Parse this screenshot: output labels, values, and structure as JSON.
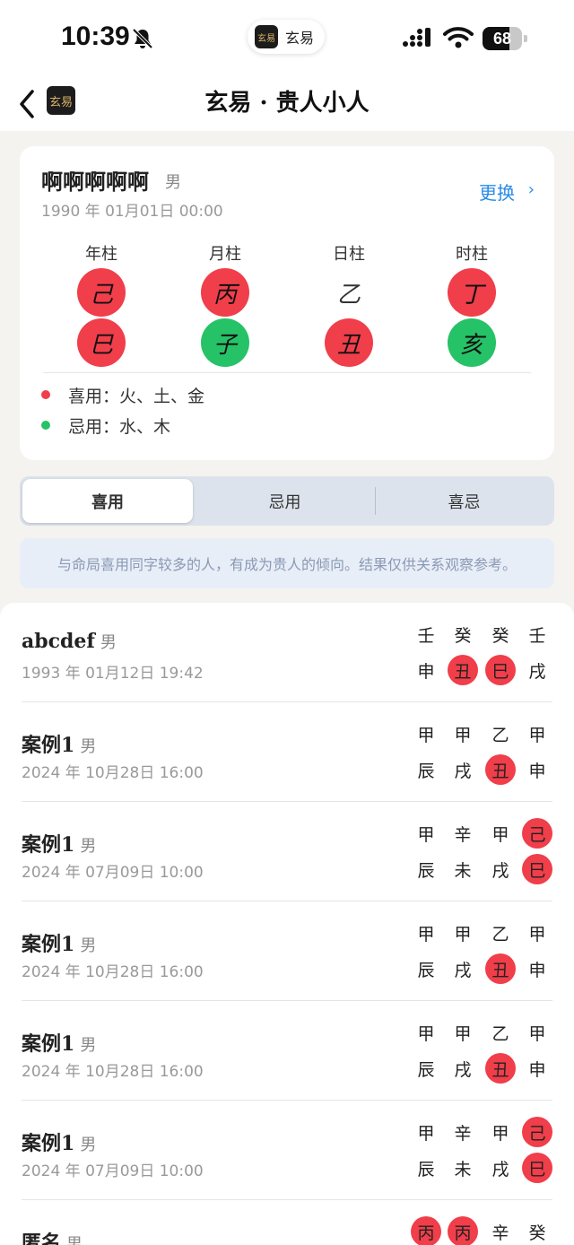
{
  "status_bar": {
    "time": "10:39",
    "app_pill_logo": "玄易",
    "app_pill_text": "玄易",
    "battery": "68",
    "battery_level": 0.68
  },
  "nav": {
    "logo": "玄易",
    "title": "玄易 · 贵人小人"
  },
  "profile": {
    "name": "啊啊啊啊啊",
    "gender": "男",
    "date": "1990 年 01月01日  00:00",
    "change_label": "更换",
    "change_chevron": "›",
    "pillars": [
      {
        "label": "年柱",
        "stem": "己",
        "stem_color": "red",
        "branch": "巳",
        "branch_color": "red"
      },
      {
        "label": "月柱",
        "stem": "丙",
        "stem_color": "red",
        "branch": "子",
        "branch_color": "green"
      },
      {
        "label": "日柱",
        "stem": "乙",
        "stem_color": "none",
        "branch": "丑",
        "branch_color": "red"
      },
      {
        "label": "时柱",
        "stem": "丁",
        "stem_color": "red",
        "branch": "亥",
        "branch_color": "green"
      }
    ],
    "favorable": "喜用：火、土、金",
    "unfavorable": "忌用：水、木",
    "favorable_color": "#f03e4a",
    "unfavorable_color": "#26c267"
  },
  "tabs": [
    {
      "label": "喜用",
      "active": true
    },
    {
      "label": "忌用",
      "active": false
    },
    {
      "label": "喜忌",
      "active": false
    }
  ],
  "notice": "与命局喜用同字较多的人，有成为贵人的倾向。结果仅供关系观察参考。",
  "list": [
    {
      "name": "abcdef",
      "gender": "男",
      "date": "1993 年 01月12日  19:42",
      "stems": [
        {
          "c": "壬",
          "hl": ""
        },
        {
          "c": "癸",
          "hl": ""
        },
        {
          "c": "癸",
          "hl": ""
        },
        {
          "c": "壬",
          "hl": ""
        }
      ],
      "branches": [
        {
          "c": "申",
          "hl": ""
        },
        {
          "c": "丑",
          "hl": "red"
        },
        {
          "c": "巳",
          "hl": "red"
        },
        {
          "c": "戌",
          "hl": ""
        }
      ]
    },
    {
      "name": "案例1",
      "gender": "男",
      "date": "2024 年 10月28日  16:00",
      "stems": [
        {
          "c": "甲",
          "hl": ""
        },
        {
          "c": "甲",
          "hl": ""
        },
        {
          "c": "乙",
          "hl": ""
        },
        {
          "c": "甲",
          "hl": ""
        }
      ],
      "branches": [
        {
          "c": "辰",
          "hl": ""
        },
        {
          "c": "戌",
          "hl": ""
        },
        {
          "c": "丑",
          "hl": "red"
        },
        {
          "c": "申",
          "hl": ""
        }
      ]
    },
    {
      "name": "案例1",
      "gender": "男",
      "date": "2024 年 07月09日  10:00",
      "stems": [
        {
          "c": "甲",
          "hl": ""
        },
        {
          "c": "辛",
          "hl": ""
        },
        {
          "c": "甲",
          "hl": ""
        },
        {
          "c": "己",
          "hl": "red"
        }
      ],
      "branches": [
        {
          "c": "辰",
          "hl": ""
        },
        {
          "c": "未",
          "hl": ""
        },
        {
          "c": "戌",
          "hl": ""
        },
        {
          "c": "巳",
          "hl": "red"
        }
      ]
    },
    {
      "name": "案例1",
      "gender": "男",
      "date": "2024 年 10月28日  16:00",
      "stems": [
        {
          "c": "甲",
          "hl": ""
        },
        {
          "c": "甲",
          "hl": ""
        },
        {
          "c": "乙",
          "hl": ""
        },
        {
          "c": "甲",
          "hl": ""
        }
      ],
      "branches": [
        {
          "c": "辰",
          "hl": ""
        },
        {
          "c": "戌",
          "hl": ""
        },
        {
          "c": "丑",
          "hl": "red"
        },
        {
          "c": "申",
          "hl": ""
        }
      ]
    },
    {
      "name": "案例1",
      "gender": "男",
      "date": "2024 年 10月28日  16:00",
      "stems": [
        {
          "c": "甲",
          "hl": ""
        },
        {
          "c": "甲",
          "hl": ""
        },
        {
          "c": "乙",
          "hl": ""
        },
        {
          "c": "甲",
          "hl": ""
        }
      ],
      "branches": [
        {
          "c": "辰",
          "hl": ""
        },
        {
          "c": "戌",
          "hl": ""
        },
        {
          "c": "丑",
          "hl": "red"
        },
        {
          "c": "申",
          "hl": ""
        }
      ]
    },
    {
      "name": "案例1",
      "gender": "男",
      "date": "2024 年 07月09日  10:00",
      "stems": [
        {
          "c": "甲",
          "hl": ""
        },
        {
          "c": "辛",
          "hl": ""
        },
        {
          "c": "甲",
          "hl": ""
        },
        {
          "c": "己",
          "hl": "red"
        }
      ],
      "branches": [
        {
          "c": "辰",
          "hl": ""
        },
        {
          "c": "未",
          "hl": ""
        },
        {
          "c": "戌",
          "hl": ""
        },
        {
          "c": "巳",
          "hl": "red"
        }
      ]
    },
    {
      "name": "匿名",
      "gender": "男",
      "date": "",
      "stems": [
        {
          "c": "丙",
          "hl": "red"
        },
        {
          "c": "丙",
          "hl": "red"
        },
        {
          "c": "辛",
          "hl": ""
        },
        {
          "c": "癸",
          "hl": ""
        }
      ],
      "branches": []
    }
  ]
}
